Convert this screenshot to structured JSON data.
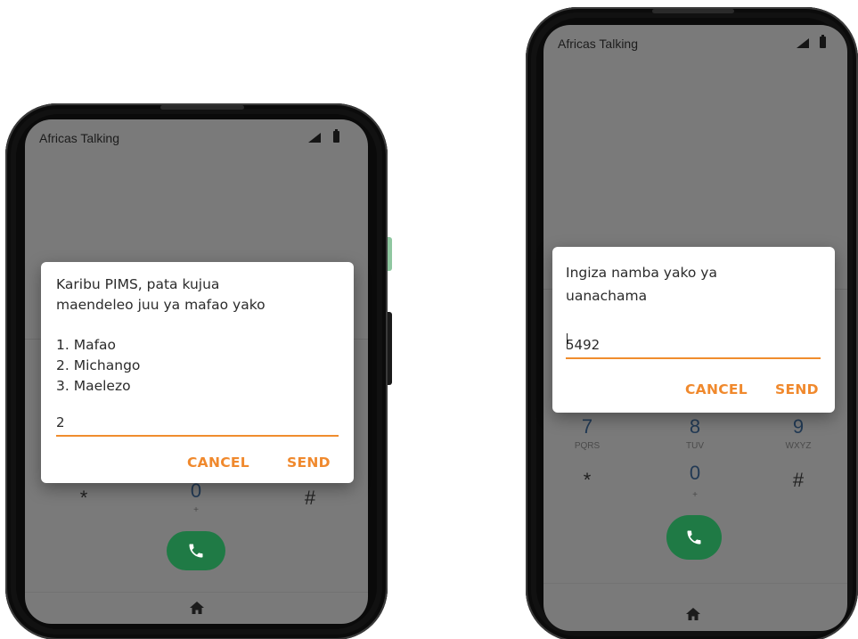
{
  "left_phone": {
    "app_title": "Africas Talking",
    "dialog": {
      "message_line1": "Karibu PIMS, pata kujua",
      "message_line2": "maendeleo juu ya mafao yako",
      "menu_items": [
        "1. Mafao",
        "2. Michango",
        "3. Maelezo"
      ],
      "input_value": "2",
      "cancel_label": "CANCEL",
      "send_label": "SEND"
    },
    "keypad": {
      "star": "*",
      "zero": "0",
      "zero_sub": "+",
      "hash": "#"
    }
  },
  "right_phone": {
    "app_title": "Africas Talking",
    "dialog": {
      "message_line1": "Ingiza namba yako ya",
      "message_line2": "uanachama",
      "input_value": "5492",
      "cancel_label": "CANCEL",
      "send_label": "SEND"
    },
    "keypad": {
      "row3": [
        {
          "digit": "7",
          "letters": "PQRS"
        },
        {
          "digit": "8",
          "letters": "TUV"
        },
        {
          "digit": "9",
          "letters": "WXYZ"
        }
      ],
      "star": "*",
      "zero": "0",
      "zero_sub": "+",
      "hash": "#"
    }
  },
  "colors": {
    "accent": "#f0892d",
    "call_button": "#1f7a45",
    "screen_dim": "#7a7a7a",
    "keypad_digit": "#223a55"
  },
  "icons": [
    "signal-icon",
    "battery-icon",
    "phone-icon",
    "home-icon"
  ]
}
